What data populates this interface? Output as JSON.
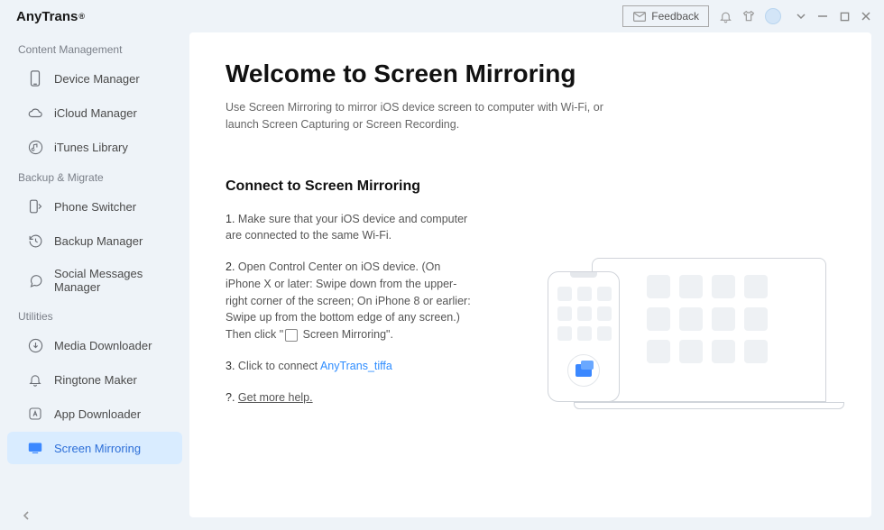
{
  "app": {
    "name": "AnyTrans",
    "reg": "®"
  },
  "titlebar": {
    "feedback": "Feedback"
  },
  "sidebar": {
    "section_content": "Content Management",
    "section_backup": "Backup & Migrate",
    "section_utilities": "Utilities",
    "items": {
      "device_manager": "Device Manager",
      "icloud_manager": "iCloud Manager",
      "itunes_library": "iTunes Library",
      "phone_switcher": "Phone Switcher",
      "backup_manager": "Backup Manager",
      "social_manager": "Social Messages Manager",
      "media_downloader": "Media Downloader",
      "ringtone_maker": "Ringtone Maker",
      "app_downloader": "App Downloader",
      "screen_mirroring": "Screen Mirroring"
    }
  },
  "main": {
    "title": "Welcome to Screen Mirroring",
    "subtitle": "Use Screen Mirroring to mirror iOS device screen to computer with Wi-Fi, or launch Screen Capturing or Screen Recording.",
    "section_heading": "Connect to Screen Mirroring",
    "step1_num": "1.",
    "step1": "Make sure that your iOS device and computer are connected to the same Wi-Fi.",
    "step2_num": "2.",
    "step2_a": "Open Control Center on iOS device. (On iPhone X or later: Swipe down from the upper-right corner of the screen; On iPhone 8 or earlier: Swipe up from the bottom edge of any screen.) Then click \"",
    "step2_b": "  Screen Mirroring\".",
    "step3_num": "3.",
    "step3_a": "Click to connect  ",
    "step3_link": "AnyTrans_tiffa",
    "help_num": "?.",
    "help_link": "Get more help."
  }
}
